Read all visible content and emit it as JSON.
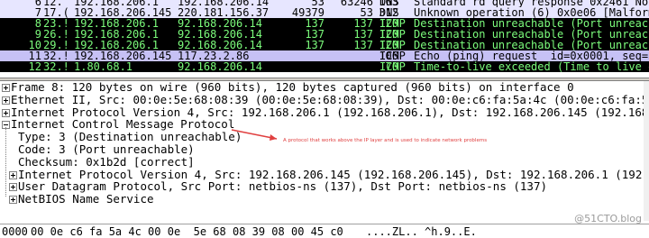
{
  "packets": [
    {
      "no": "6",
      "time": "12.",
      "src": "192.168.206.1",
      "dst": "192.168.206.14",
      "sport": "53",
      "dport": "63246",
      "len": "163",
      "proto": "DNS",
      "info": "Standard rd query response 0x2461 No such",
      "bg": "#e7e6ff",
      "fg": "#000000"
    },
    {
      "no": "7",
      "time": "17.(",
      "src": "192.168.206.145",
      "dst": "220.181.156.37",
      "sport": "49379",
      "dport": "53",
      "len": "312",
      "proto": "DNS",
      "info": "Unknown operation (6) 0x0e06 [Malform",
      "bg": "#e7e6ff",
      "fg": "#000000"
    },
    {
      "no": "8",
      "time": "23.!",
      "src": "192.168.206.1",
      "dst": "92.168.206.14",
      "sport": "137",
      "dport": "137",
      "len": "120",
      "proto": "ICMP",
      "info": "Destination unreachable (Port unreach",
      "bg": "#000000",
      "fg": "#7cfc7c"
    },
    {
      "no": "9",
      "time": "26.!",
      "src": "192.168.206.1",
      "dst": "92.168.206.14",
      "sport": "137",
      "dport": "137",
      "len": "120",
      "proto": "ICMP",
      "info": "Destination unreachable (Port unreach",
      "bg": "#000000",
      "fg": "#7cfc7c"
    },
    {
      "no": "10",
      "time": "29.!",
      "src": "192.168.206.1",
      "dst": "92.168.206.14",
      "sport": "137",
      "dport": "137",
      "len": "120",
      "proto": "ICMP",
      "info": "Destination unreachable (Port unreach",
      "bg": "#000000",
      "fg": "#7cfc7c"
    },
    {
      "no": "11",
      "time": "32.!",
      "src": "192.168.206.145",
      "dst": "117.23.2.86",
      "sport": "",
      "dport": "",
      "len": "106",
      "proto": "ICMP",
      "info": "Echo (ping) request  id=0x0001, seq=3",
      "bg": "#c6c1f5",
      "fg": "#000000"
    },
    {
      "no": "12",
      "time": "32.!",
      "src": "1.80.68.1",
      "dst": "92.168.206.14",
      "sport": "",
      "dport": "",
      "len": "70",
      "proto": "ICMP",
      "info": "Time-to-live exceeded (Time to live e",
      "bg": "#000000",
      "fg": "#7cfc7c"
    }
  ],
  "details": [
    {
      "text": "Frame 8: 120 bytes on wire (960 bits), 120 bytes captured (960 bits) on interface 0",
      "expanded": false
    },
    {
      "text": "Ethernet II, Src: 00:0e:5e:68:08:39 (00:0e:5e:68:08:39), Dst: 00:0e:c6:fa:5a:4c (00:0e:c6:fa:5a:4c)",
      "expanded": false
    },
    {
      "text": "Internet Protocol Version 4, Src: 192.168.206.1 (192.168.206.1), Dst: 192.168.206.145 (192.168.206.145)",
      "expanded": false
    },
    {
      "text": "Internet Control Message Protocol",
      "expanded": true
    }
  ],
  "icmp_children": [
    "Type: 3 (Destination unreachable)",
    "Code: 3 (Port unreachable)",
    "Checksum: 0x1b2d [correct]"
  ],
  "icmp_nested": [
    {
      "text": "Internet Protocol Version 4, Src: 192.168.206.145 (192.168.206.145), Dst: 192.168.206.1 (192.168.206.1)",
      "expanded": false
    },
    {
      "text": "User Datagram Protocol, Src Port: netbios-ns (137), Dst Port: netbios-ns (137)",
      "expanded": false
    },
    {
      "text": "NetBIOS Name Service",
      "expanded": false
    }
  ],
  "annotation": "A protocol that works above the IP layer and is used to indicate network problems",
  "hex": {
    "offset": "0000",
    "bytes": "00 0e c6 fa 5a 4c 00 0e  5e 68 08 39 08 00 45 c0",
    "ascii": "....ZL.. ^h.9..E."
  },
  "watermark": "@51CTO.blog",
  "colors": {
    "icmp_error_bg": "#000000",
    "icmp_error_fg": "#7cfc7c",
    "dns_bg": "#e7e6ff",
    "echo_bg": "#c6c1f5",
    "annotation": "#e04040"
  }
}
